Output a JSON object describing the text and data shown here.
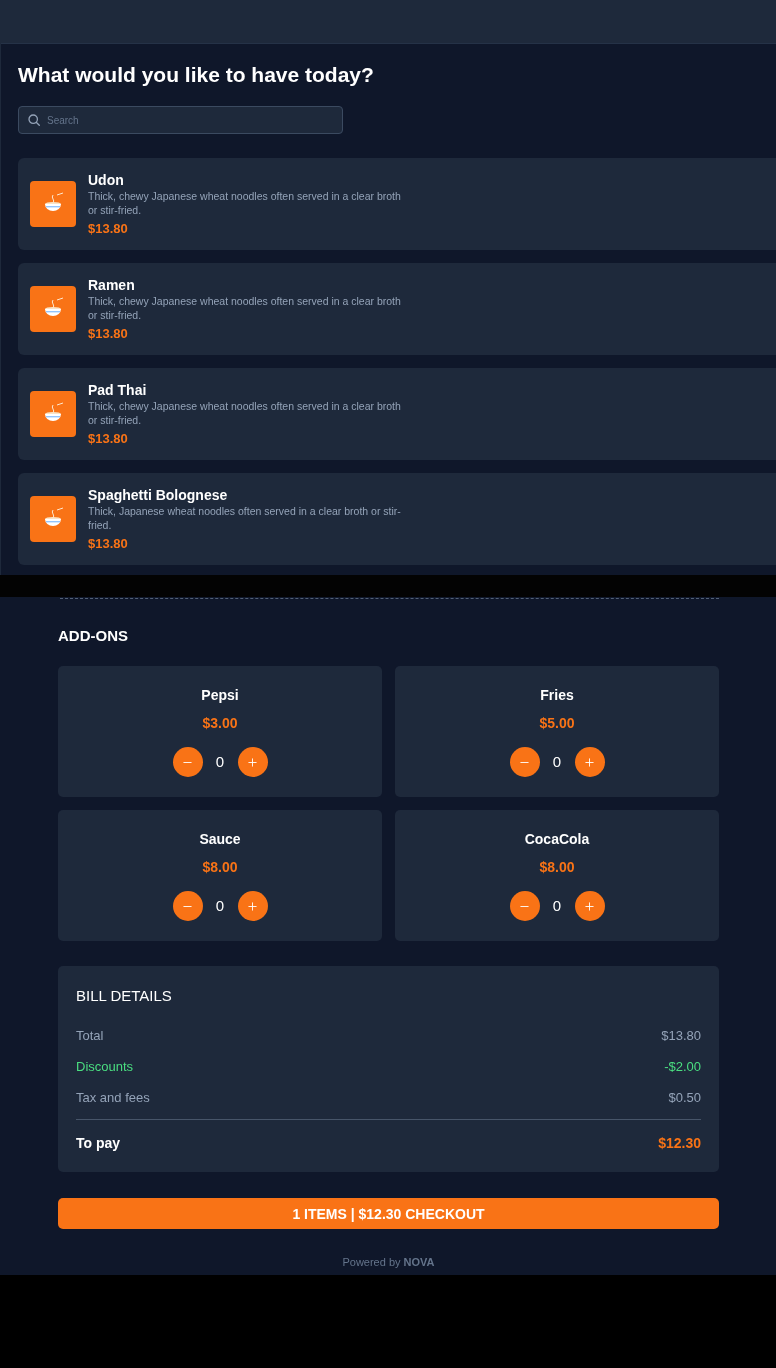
{
  "menu": {
    "title": "What would you like to have today?",
    "search": {
      "placeholder": "Search"
    },
    "items": [
      {
        "name": "Udon",
        "description": "Thick, chewy Japanese wheat noodles often served in a clear broth or stir-fried.",
        "price": "$13.80"
      },
      {
        "name": "Ramen",
        "description": "Thick, chewy Japanese wheat noodles often served in a clear broth or stir-fried.",
        "price": "$13.80"
      },
      {
        "name": "Pad Thai",
        "description": "Thick, chewy Japanese wheat noodles often served in a clear broth or stir-fried.",
        "price": "$13.80"
      },
      {
        "name": "Spaghetti Bolognese",
        "description": "Thick, Japanese wheat noodles often served in a clear broth or stir-fried.",
        "price": "$13.80"
      }
    ]
  },
  "add_ons": {
    "title": "ADD-ONS",
    "items": [
      {
        "name": "Pepsi",
        "price": "$3.00",
        "quantity": "0"
      },
      {
        "name": "Fries",
        "price": "$5.00",
        "quantity": "0"
      },
      {
        "name": "Sauce",
        "price": "$8.00",
        "quantity": "0"
      },
      {
        "name": "CocaCola",
        "price": "$8.00",
        "quantity": "0"
      }
    ]
  },
  "bill": {
    "title": "BILL DETAILS",
    "rows": [
      {
        "kind": "charge",
        "label": "Total",
        "value": "$13.80"
      },
      {
        "kind": "discount",
        "label": "Discounts",
        "value": "-$2.00"
      },
      {
        "kind": "charge",
        "label": "Tax and fees",
        "value": "$0.50"
      }
    ],
    "to_pay": {
      "label": "To pay",
      "value": "$12.30"
    }
  },
  "checkout_button": "1 ITEMS | $12.30 CHECKOUT",
  "footer": "Powered by **NOVA**"
}
